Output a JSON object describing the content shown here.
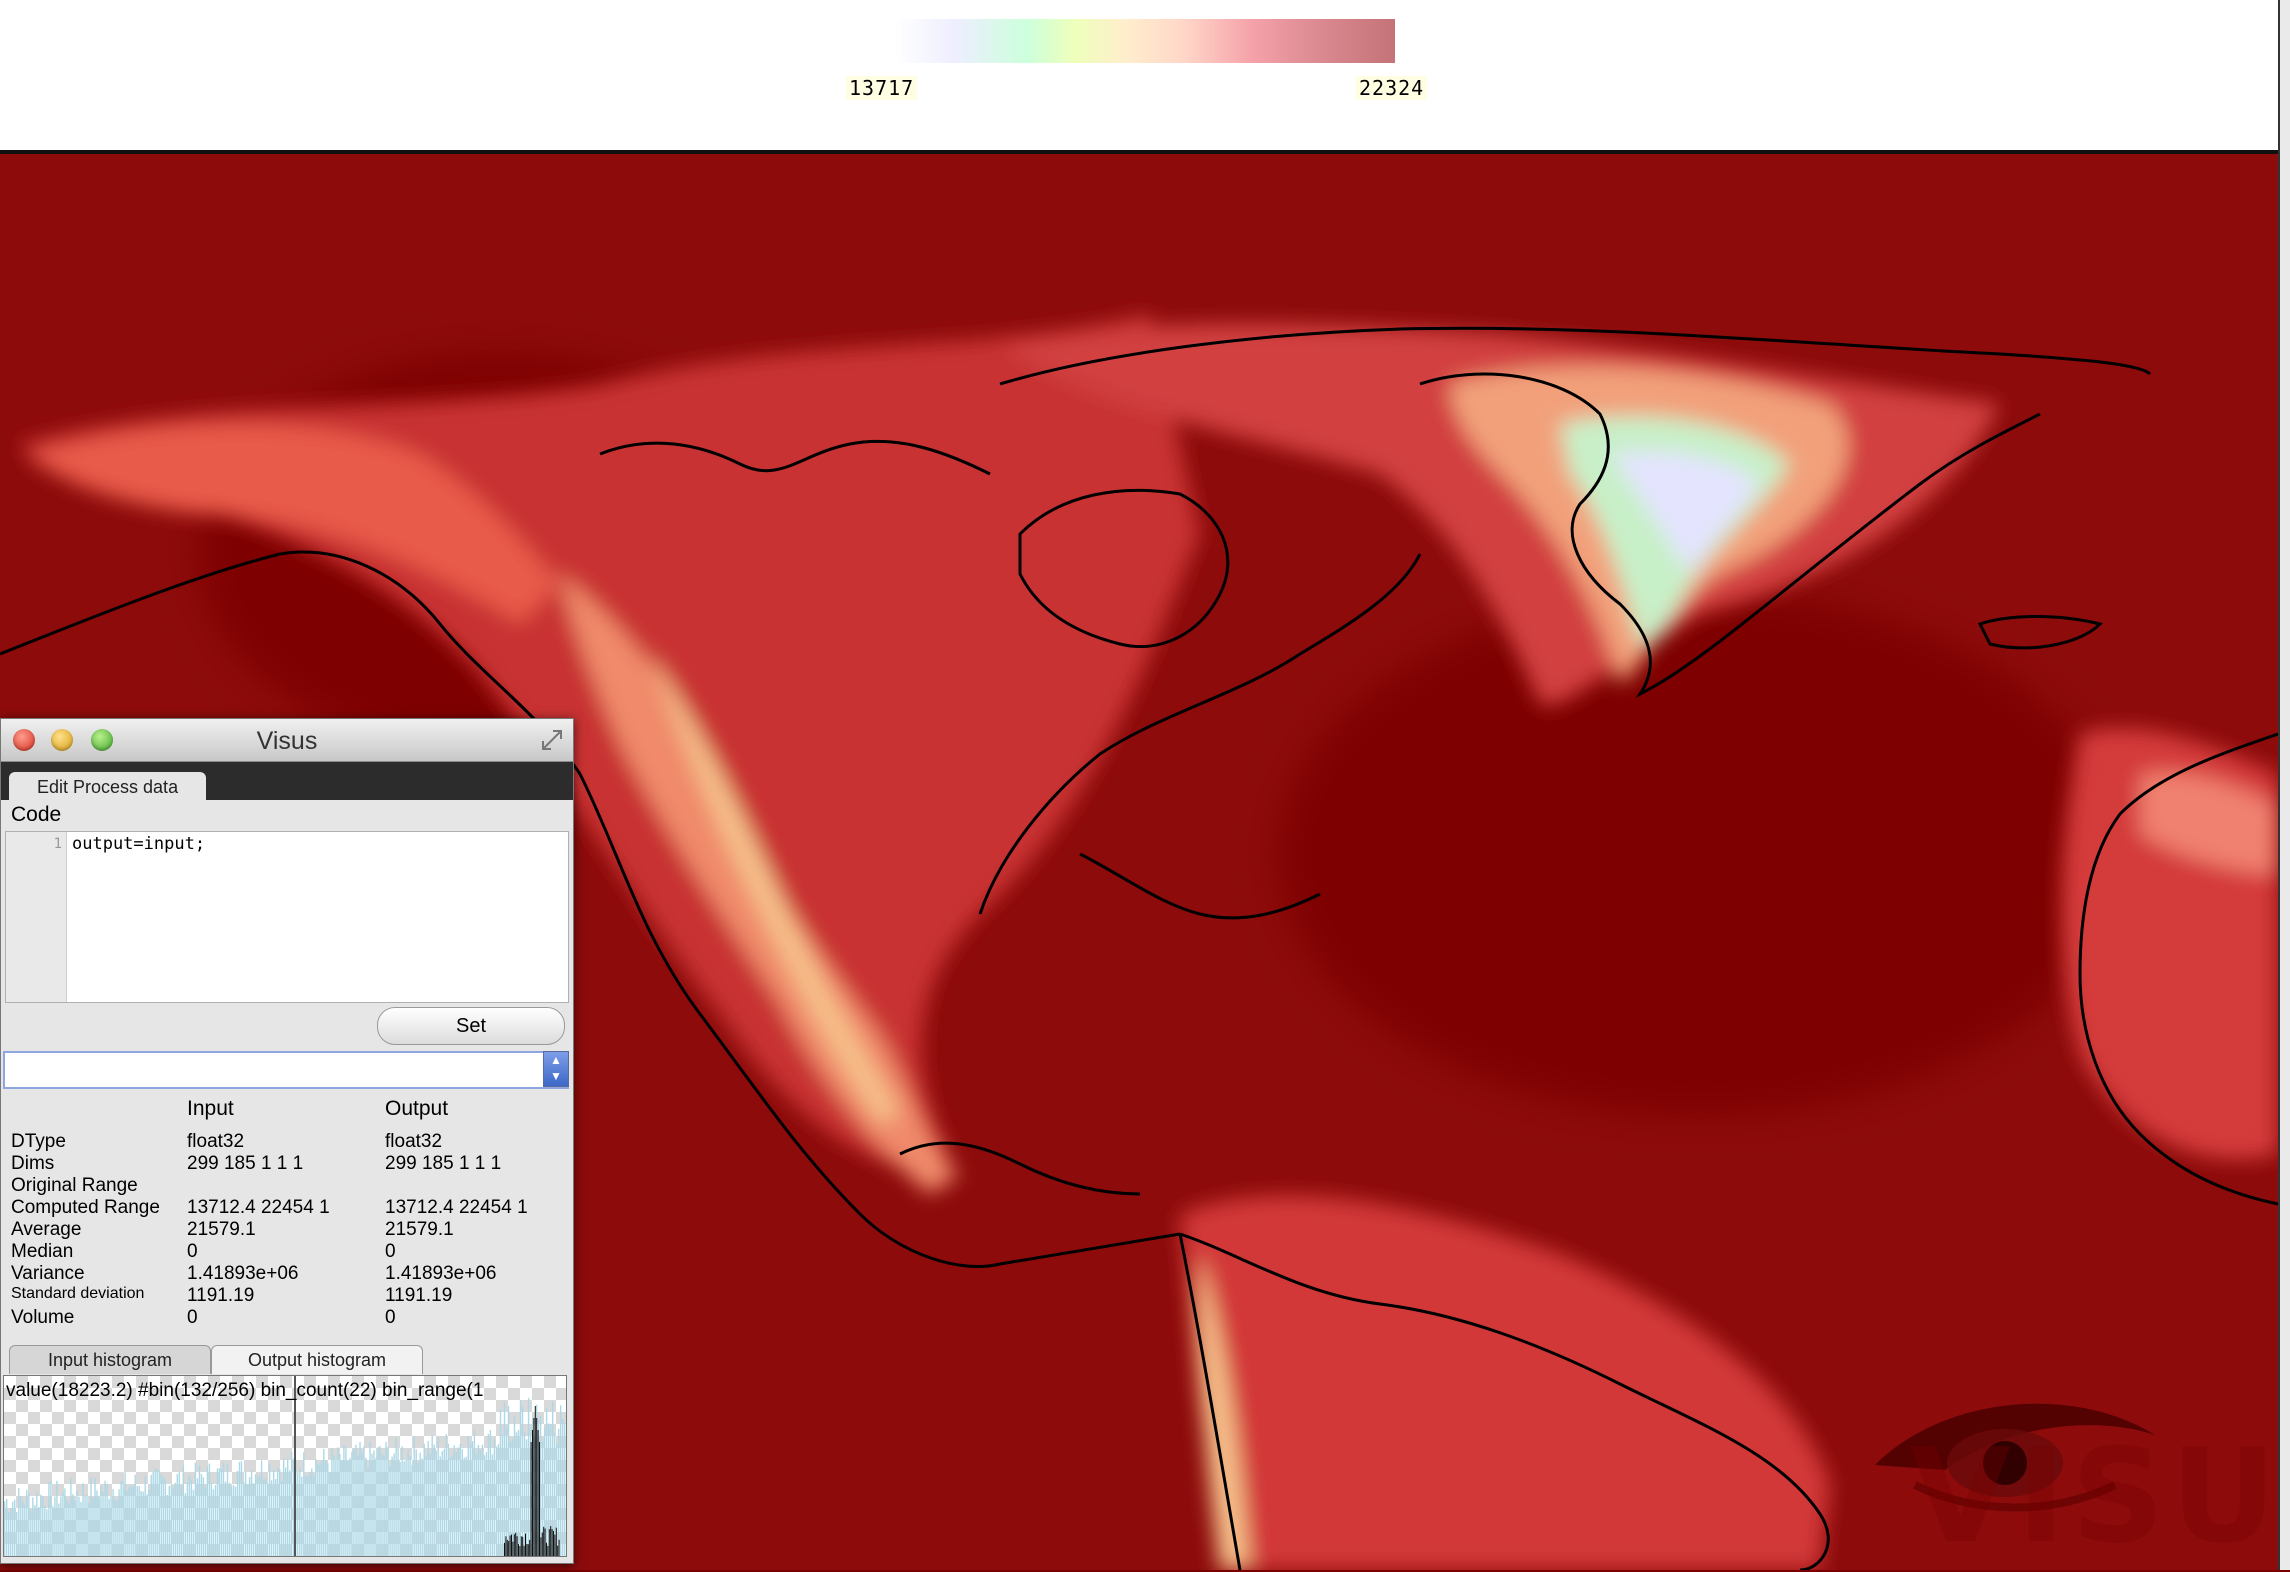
{
  "colorbar": {
    "min_label": "13717",
    "max_label": "22324"
  },
  "watermark": {
    "text": "VISUS"
  },
  "dialog": {
    "title": "Visus",
    "tab_label": "Edit Process data",
    "code_label": "Code",
    "code_line_number": "1",
    "code_text": "output=input;",
    "set_label": "Set",
    "combo_value": "",
    "columns": {
      "input": "Input",
      "output": "Output"
    },
    "stats": [
      {
        "label": "DType",
        "input": "float32",
        "output": "float32"
      },
      {
        "label": "Dims",
        "input": "299 185 1 1 1",
        "output": "299 185 1 1 1"
      },
      {
        "label": "Original Range",
        "input": "",
        "output": ""
      },
      {
        "label": "Computed Range",
        "input": "13712.4 22454 1",
        "output": "13712.4 22454 1"
      },
      {
        "label": "Average",
        "input": "21579.1",
        "output": "21579.1"
      },
      {
        "label": "Median",
        "input": "0",
        "output": "0"
      },
      {
        "label": "Variance",
        "input": "1.41893e+06",
        "output": "1.41893e+06"
      },
      {
        "label": "Standard deviation",
        "input": "1191.19",
        "output": "1191.19"
      },
      {
        "label": "Volume",
        "input": "0",
        "output": "0"
      }
    ],
    "hist_tabs": {
      "input": "Input histogram",
      "output": "Output histogram"
    },
    "hist_readout": "value(18223.2) #bin(132/256) bin_count(22) bin_range(1"
  },
  "colors": {
    "map_base": "#8d0b0b",
    "hist_bars": "#add8e6",
    "coast": "#000000"
  }
}
